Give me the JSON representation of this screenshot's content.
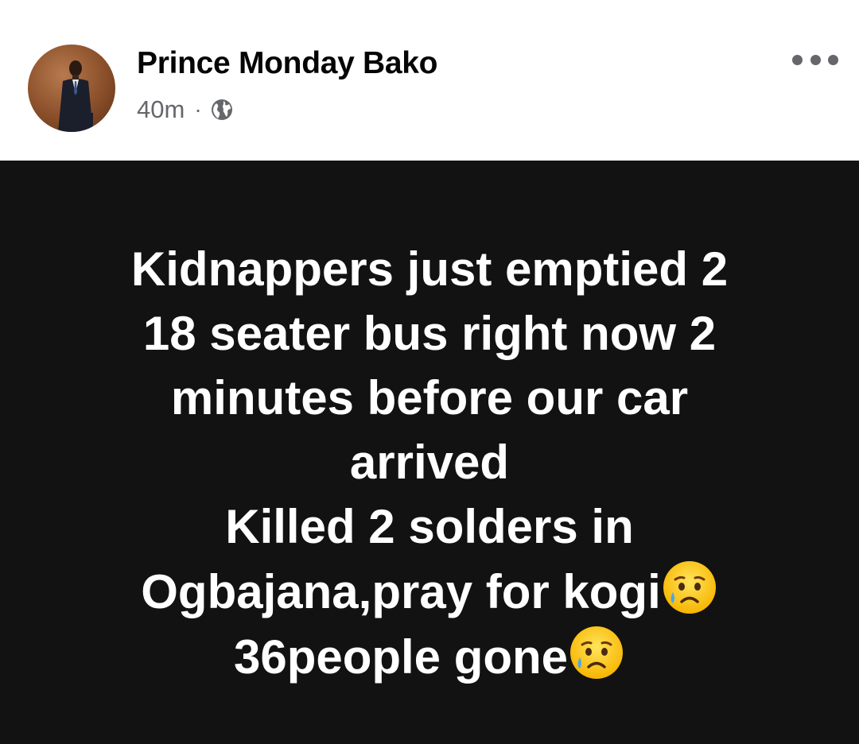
{
  "post": {
    "author": "Prince Monday Bako",
    "time": "40m",
    "separator": "·",
    "privacy_icon": "globe-icon",
    "menu_icon": "more-options-icon",
    "background_color": "#121212",
    "text_color": "#ffffff",
    "lines": [
      "Kidnappers just emptied 2",
      " 18 seater bus right now 2",
      "minutes before our car",
      "arrived",
      "Killed 2 solders in",
      "Ogbajana,pray for kogi",
      "36people gone"
    ],
    "emoji": "sad-but-relieved-face"
  }
}
